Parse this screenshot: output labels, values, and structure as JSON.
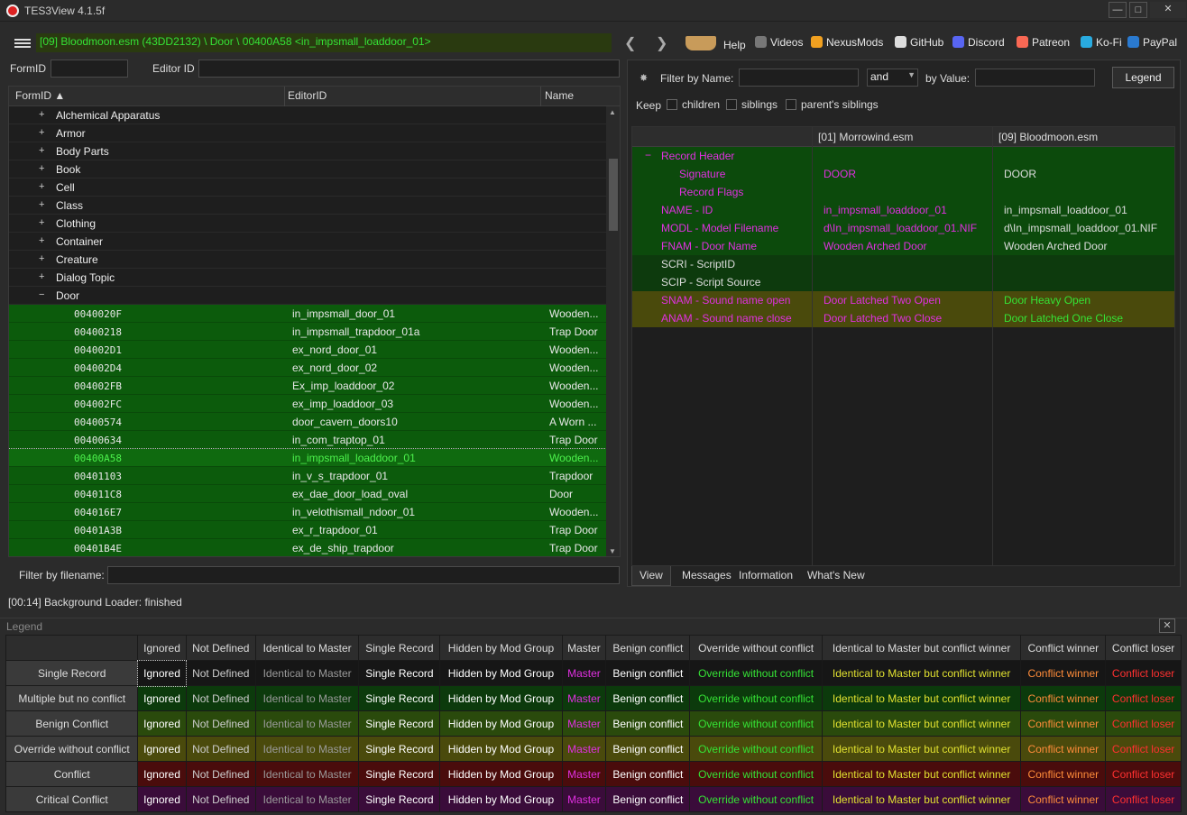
{
  "window": {
    "title": "TES3View 4.1.5f"
  },
  "path": "[09] Bloodmoon.esm (43DD2132) \\ Door \\ 00400A58 <in_impsmall_loaddoor_01>",
  "toplinks": [
    {
      "label": "Help",
      "icon": "book-icon",
      "color": "#c89b5a"
    },
    {
      "label": "Videos",
      "icon": "gp-icon",
      "color": "#777777"
    },
    {
      "label": "NexusMods",
      "icon": "nexusmods-icon",
      "color": "#f0a020"
    },
    {
      "label": "GitHub",
      "icon": "github-icon",
      "color": "#dddddd"
    },
    {
      "label": "Discord",
      "icon": "discord-icon",
      "color": "#5865f2"
    },
    {
      "label": "Patreon",
      "icon": "patreon-icon",
      "color": "#f96854"
    },
    {
      "label": "Ko-Fi",
      "icon": "kofi-icon",
      "color": "#29abe0"
    },
    {
      "label": "PayPal",
      "icon": "paypal-icon",
      "color": "#2a7ad0"
    }
  ],
  "search": {
    "formid_label": "FormID",
    "editorid_label": "Editor ID",
    "filename_label": "Filter by filename:"
  },
  "tree": {
    "headers": {
      "formid": "FormID",
      "editorid": "EditorID",
      "name": "Name"
    },
    "categories": [
      "Alchemical Apparatus",
      "Armor",
      "Body Parts",
      "Book",
      "Cell",
      "Class",
      "Clothing",
      "Container",
      "Creature",
      "Dialog Topic"
    ],
    "open_category": "Door",
    "doors": [
      {
        "id": "0040020F",
        "editor": "in_impsmall_door_01",
        "name": "Wooden..."
      },
      {
        "id": "00400218",
        "editor": "in_impsmall_trapdoor_01a",
        "name": "Trap Door"
      },
      {
        "id": "004002D1",
        "editor": "ex_nord_door_01",
        "name": "Wooden..."
      },
      {
        "id": "004002D4",
        "editor": "ex_nord_door_02",
        "name": "Wooden..."
      },
      {
        "id": "004002FB",
        "editor": "Ex_imp_loaddoor_02",
        "name": "Wooden..."
      },
      {
        "id": "004002FC",
        "editor": "ex_imp_loaddoor_03",
        "name": "Wooden..."
      },
      {
        "id": "00400574",
        "editor": "door_cavern_doors10",
        "name": "A Worn ..."
      },
      {
        "id": "00400634",
        "editor": "in_com_traptop_01",
        "name": "Trap Door"
      },
      {
        "id": "00400A58",
        "editor": "in_impsmall_loaddoor_01",
        "name": "Wooden...",
        "selected": true
      },
      {
        "id": "00401103",
        "editor": "in_v_s_trapdoor_01",
        "name": "Trapdoor"
      },
      {
        "id": "004011C8",
        "editor": "ex_dae_door_load_oval",
        "name": "Door"
      },
      {
        "id": "004016E7",
        "editor": "in_velothismall_ndoor_01",
        "name": "Wooden..."
      },
      {
        "id": "00401A3B",
        "editor": "ex_r_trapdoor_01",
        "name": "Trap Door"
      },
      {
        "id": "00401B4E",
        "editor": "ex_de_ship_trapdoor",
        "name": "Trap Door"
      }
    ]
  },
  "filter": {
    "name_label": "Filter by Name:",
    "op": "and",
    "value_label": "by Value:",
    "legend_btn": "Legend",
    "keep_label": "Keep",
    "keep_opts": [
      "children",
      "siblings",
      "parent's siblings"
    ]
  },
  "record": {
    "col1": "[01] Morrowind.esm",
    "col2": "[09] Bloodmoon.esm",
    "rows": [
      {
        "key": "Record Header",
        "v1": "",
        "v2": "",
        "kc": "mag",
        "c1": "mag",
        "c2": "wht",
        "bg": "#0c4a0c",
        "indent": 32,
        "minus": true
      },
      {
        "key": "Signature",
        "v1": "DOOR",
        "v2": "DOOR",
        "kc": "mag",
        "c1": "mag",
        "c2": "wht",
        "bg": "#0c4a0c",
        "indent": 52
      },
      {
        "key": "Record Flags",
        "v1": "",
        "v2": "",
        "kc": "mag",
        "c1": "mag",
        "c2": "wht",
        "bg": "#0c4a0c",
        "indent": 52
      },
      {
        "key": "NAME - ID",
        "v1": "in_impsmall_loaddoor_01",
        "v2": "in_impsmall_loaddoor_01",
        "kc": "mag",
        "c1": "mag",
        "c2": "wht",
        "bg": "#0c4a0c",
        "indent": 32
      },
      {
        "key": "MODL - Model Filename",
        "v1": "d\\In_impsmall_loaddoor_01.NIF",
        "v2": "d\\In_impsmall_loaddoor_01.NIF",
        "kc": "mag",
        "c1": "mag",
        "c2": "wht",
        "bg": "#0c4a0c",
        "indent": 32
      },
      {
        "key": "FNAM - Door Name",
        "v1": "Wooden Arched Door",
        "v2": "Wooden Arched Door",
        "kc": "mag",
        "c1": "mag",
        "c2": "wht",
        "bg": "#0c4a0c",
        "indent": 32
      },
      {
        "key": "SCRI - ScriptID",
        "v1": "",
        "v2": "",
        "kc": "wht",
        "c1": "wht",
        "c2": "wht",
        "bg": "#0d3a0d",
        "indent": 32
      },
      {
        "key": "SCIP - Script Source",
        "v1": "",
        "v2": "",
        "kc": "wht",
        "c1": "wht",
        "c2": "wht",
        "bg": "#0d3a0d",
        "indent": 32
      },
      {
        "key": "SNAM - Sound name open",
        "v1": "Door Latched Two Open",
        "v2": "Door Heavy Open",
        "kc": "mag",
        "c1": "mag",
        "c2": "grn",
        "bg": "#4a4a0c",
        "indent": 32
      },
      {
        "key": "ANAM - Sound name close",
        "v1": "Door Latched Two Close",
        "v2": "Door Latched One Close",
        "kc": "mag",
        "c1": "mag",
        "c2": "grn",
        "bg": "#4a4a0c",
        "indent": 32
      }
    ]
  },
  "tabs": [
    "View",
    "Messages",
    "Information",
    "What's New"
  ],
  "status": "[00:14] Background Loader: finished",
  "legend": {
    "title": "Legend",
    "cols": [
      "Ignored",
      "Not Defined",
      "Identical to Master",
      "Single Record",
      "Hidden by Mod Group",
      "Master",
      "Benign conflict",
      "Override without conflict",
      "Identical to Master but conflict winner",
      "Conflict winner",
      "Conflict loser"
    ],
    "col_colors": [
      "#ffffff",
      "#cccccc",
      "#9a9a9a",
      "#ffffff",
      "#ffffff",
      "#e030e0",
      "#ffffff",
      "#35e235",
      "#e0e030",
      "#ff8c3a",
      "#ff3030"
    ],
    "rows": [
      {
        "label": "Single Record",
        "bg": "#161616"
      },
      {
        "label": "Multiple but no conflict",
        "bg": "#0c3a0c"
      },
      {
        "label": "Benign Conflict",
        "bg": "#2a4a0c"
      },
      {
        "label": "Override without conflict",
        "bg": "#4a4a0c"
      },
      {
        "label": "Conflict",
        "bg": "#4a0c0c"
      },
      {
        "label": "Critical Conflict",
        "bg": "#3a0c3a"
      }
    ]
  }
}
